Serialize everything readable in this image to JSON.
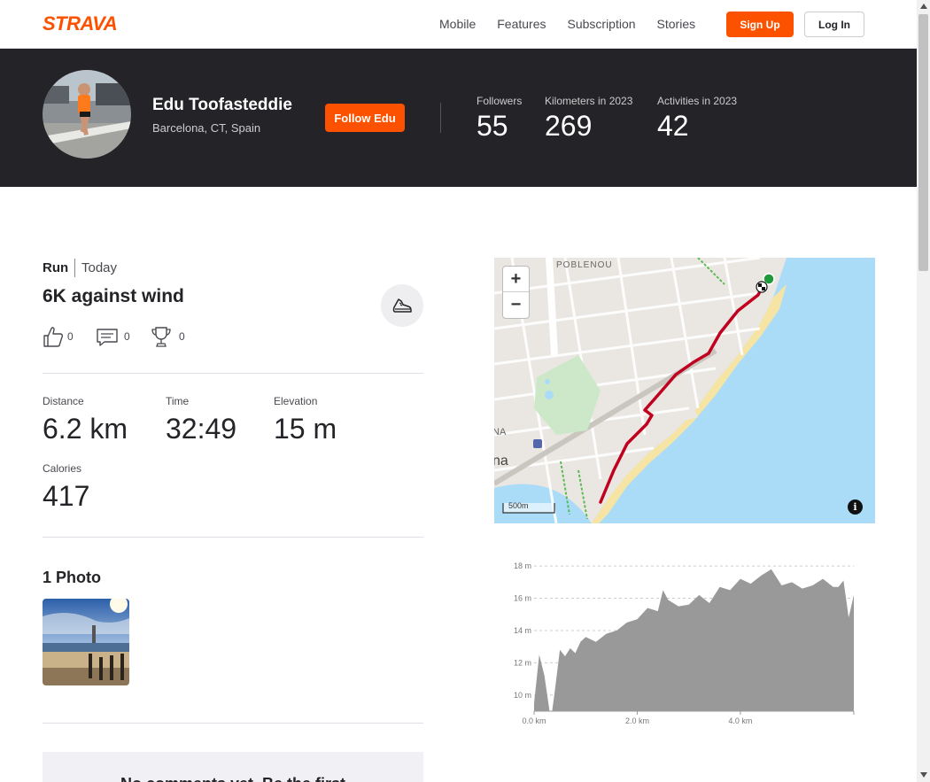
{
  "nav": {
    "logo_text": "STRAVA",
    "links": [
      "Mobile",
      "Features",
      "Subscription",
      "Stories"
    ],
    "signup_label": "Sign Up",
    "login_label": "Log In"
  },
  "athlete": {
    "name": "Edu Toofasteddie",
    "location": "Barcelona, CT, Spain",
    "follow_label": "Follow Edu",
    "stats": [
      {
        "label": "Followers",
        "value": "55"
      },
      {
        "label": "Kilometers in 2023",
        "value": "269"
      },
      {
        "label": "Activities in 2023",
        "value": "42"
      }
    ]
  },
  "activity": {
    "type": "Run",
    "date": "Today",
    "title": "6K against wind",
    "kudos_count": "0",
    "comments_count": "0",
    "achievements_count": "0",
    "metrics": [
      {
        "label": "Distance",
        "value": "6.2 km"
      },
      {
        "label": "Time",
        "value": "32:49"
      },
      {
        "label": "Elevation",
        "value": "15 m"
      },
      {
        "label": "Calories",
        "value": "417"
      }
    ],
    "photos_title": "1 Photo",
    "comments_empty": "No comments yet. Be the first"
  },
  "map": {
    "zoom_in": "+",
    "zoom_out": "−",
    "label_poblenou": "POBLENOU",
    "label_na": "NA",
    "label_na2": "na",
    "scale_label": "500m",
    "info": "i",
    "route_color": "#c0001f",
    "water_color": "#aadcf8"
  },
  "chart_data": {
    "type": "area",
    "title": "",
    "xlabel": "",
    "ylabel": "",
    "x_ticks": [
      "0.0 km",
      "2.0 km",
      "4.0 km"
    ],
    "y_ticks": [
      "10 m",
      "12 m",
      "14 m",
      "16 m",
      "18 m"
    ],
    "xlim": [
      0,
      6.2
    ],
    "ylim": [
      9,
      18.5
    ],
    "grid": true,
    "color": "#999999",
    "x": [
      0.0,
      0.1,
      0.2,
      0.3,
      0.35,
      0.4,
      0.5,
      0.6,
      0.7,
      0.8,
      0.9,
      1.0,
      1.2,
      1.4,
      1.6,
      1.8,
      2.0,
      2.2,
      2.4,
      2.5,
      2.6,
      2.8,
      3.0,
      3.2,
      3.4,
      3.6,
      3.8,
      4.0,
      4.2,
      4.4,
      4.6,
      4.8,
      5.0,
      5.2,
      5.4,
      5.6,
      5.8,
      5.9,
      6.0,
      6.1,
      6.2
    ],
    "y": [
      9.5,
      12.5,
      11.2,
      9.0,
      9.0,
      10.2,
      12.8,
      12.4,
      12.9,
      12.6,
      13.3,
      13.6,
      13.3,
      13.8,
      14.0,
      14.5,
      14.7,
      15.4,
      15.2,
      16.5,
      15.9,
      15.5,
      15.6,
      16.2,
      15.7,
      16.7,
      16.5,
      17.2,
      16.9,
      17.4,
      17.8,
      16.8,
      17.0,
      16.6,
      16.8,
      17.2,
      16.7,
      16.7,
      17.1,
      14.8,
      16.2
    ]
  }
}
